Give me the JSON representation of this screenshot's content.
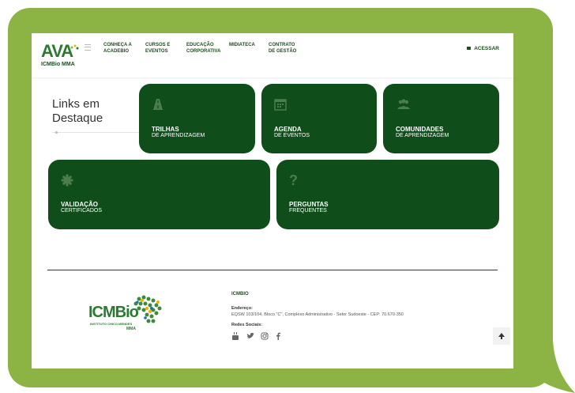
{
  "logo": {
    "name": "AVA",
    "sub": "ICMBio MMA"
  },
  "nav": {
    "items": [
      {
        "line1": "CONHEÇA A",
        "line2": "ACADEBIO"
      },
      {
        "line1": "CURSOS E",
        "line2": "EVENTOS"
      },
      {
        "line1": "EDUCAÇÃO",
        "line2": "CORPORATIVA"
      },
      {
        "line1": "MIDIATECA",
        "line2": ""
      },
      {
        "line1": "CONTRATO",
        "line2": "DE GESTÃO"
      }
    ],
    "acessar": "ACESSAR"
  },
  "links": {
    "title_line1": "Links em",
    "title_line2": "Destaque"
  },
  "cards": [
    {
      "title": "TRILHAS",
      "subtitle": "DE APRENDIZAGEM",
      "icon": "road-icon"
    },
    {
      "title": "AGENDA",
      "subtitle": "DE EVENTOS",
      "icon": "calendar-icon"
    },
    {
      "title": "COMUNIDADES",
      "subtitle": "DE APRENDIZAGEM",
      "icon": "users-icon"
    },
    {
      "title": "VALIDAÇÃO",
      "subtitle": "CERTIFICADOS",
      "icon": "certificate-icon"
    },
    {
      "title": "PERGUNTAS",
      "subtitle": "FREQUENTES",
      "icon": "question-icon"
    }
  ],
  "footer": {
    "logo_text": "ICMBio",
    "logo_sub1": "INSTITUTO CHICO MENDES",
    "logo_sub2": "MMA",
    "org": "ICMBIO",
    "address_label": "Endereço:",
    "address": "EQSW 103/104, Bloco \"C\", Complexo Administrativo - Setor Sudoeste - CEP: 70.670-350",
    "social_label": "Redes Sociais:",
    "social": [
      "youtube-icon",
      "twitter-icon",
      "instagram-icon",
      "facebook-icon"
    ]
  },
  "colors": {
    "bubble": "#8cb445",
    "card": "#0f4d1b",
    "brand": "#2a7a30"
  }
}
